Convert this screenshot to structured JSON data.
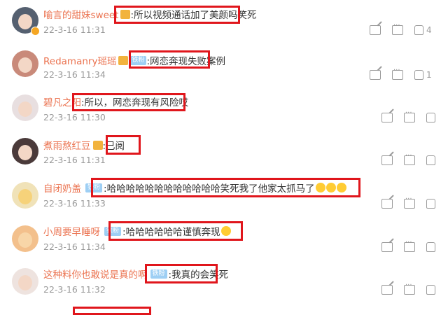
{
  "comments": [
    {
      "user": "喻言的甜妹sweet",
      "text": ":所以视频通话加了美颜吗笑死",
      "date": "22-3-16 11:31",
      "likes": "4",
      "has_medal": true,
      "fans_badge": ""
    },
    {
      "user": "Redamanry瑶瑶",
      "text": ":网恋奔现失败案例",
      "date": "22-3-16 11:34",
      "likes": "1",
      "has_medal": true,
      "fans_badge": "铁粉"
    },
    {
      "user": "碧凡之阳",
      "text": ":所以，网恋奔现有风险哎",
      "date": "22-3-16 11:30",
      "likes": "",
      "has_medal": false,
      "fans_badge": ""
    },
    {
      "user": "煮雨熬红豆",
      "text": ":已阅",
      "date": "22-3-16 11:31",
      "likes": "",
      "has_medal": true,
      "fans_badge": ""
    },
    {
      "user": "自闭奶盖",
      "text": ":哈哈哈哈哈哈哈哈哈哈哈哈笑死我了他家太抓马了",
      "date": "22-3-16 11:33",
      "likes": "",
      "has_medal": false,
      "fans_badge": "铁粉"
    },
    {
      "user": "小周要早睡呀",
      "text": ":哈哈哈哈哈哈谨慎奔现",
      "date": "22-3-16 11:34",
      "likes": "",
      "has_medal": false,
      "fans_badge": "铁粉"
    },
    {
      "user": "这种料你也敢说是真的啊",
      "text": ":我真的会笑死",
      "date": "22-3-16 11:32",
      "likes": "",
      "has_medal": false,
      "fans_badge": "铁粉"
    }
  ],
  "colors": {
    "username": "#eb7350",
    "highlight": "#e0161c",
    "meta": "#999999"
  },
  "icons": [
    "share-icon",
    "comment-icon",
    "like-icon",
    "laugh-emoji-icon"
  ]
}
